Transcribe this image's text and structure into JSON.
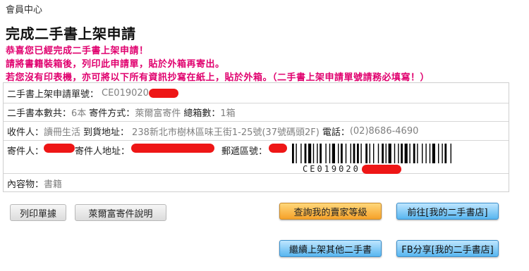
{
  "breadcrumb": "會員中心",
  "page_title": "完成二手書上架申請",
  "messages": [
    "恭喜您已經完成二手書上架申請！",
    "請將書籍裝箱後，列印此申請單，貼於外箱再寄出。",
    "若您沒有印表機，亦可將以下所有資訊抄寫在紙上，貼於外箱。（二手書上架申請單號請務必填寫！）"
  ],
  "form": {
    "app_no_label": "二手書上架申請單號：",
    "app_no_value": "CE019020",
    "book_count_label": "二手書本數共：",
    "book_count_value": "6本",
    "ship_method_label": "寄件方式：",
    "ship_method_value": "萊爾富寄件",
    "box_count_label": "總箱數：",
    "box_count_value": "1箱",
    "recipient_label": "收件人：",
    "recipient_value": "讀冊生活",
    "delivery_addr_label": "到貨地址：",
    "delivery_addr_value": "238新北市樹林區味王街1-25號(37號碼頭2F)",
    "phone_label": "電話：",
    "phone_value": "(02)8686-4690",
    "sender_label": "寄件人：",
    "sender_addr_label": "寄件人地址：",
    "postal_label": "郵遞區號：",
    "barcode_text": "CE019020",
    "contents_label": "內容物：",
    "contents_value": "書籍"
  },
  "buttons": {
    "print": "列印單據",
    "hilife_info": "萊爾富寄件說明",
    "seller_level": "查詢我的賣家等級",
    "goto_shop": "前往[我的二手書店]",
    "continue_listing": "繼續上架其他二手書",
    "fb_share": "FB分享[我的二手書店]"
  },
  "colors": {
    "accent_pink": "#e0006e",
    "redaction": "#ee1616",
    "value_gray": "#808080",
    "btn_orange": "#f6a22a",
    "btn_blue": "#58b6f0"
  }
}
